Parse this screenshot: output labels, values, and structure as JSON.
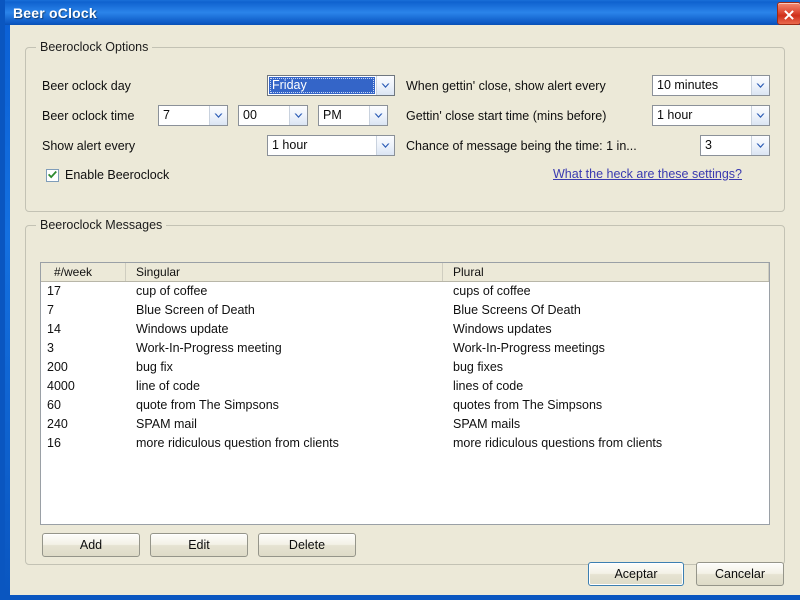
{
  "window": {
    "title": "Beer oClock",
    "close_icon": "close-icon"
  },
  "options_group": {
    "legend": "Beeroclock Options",
    "labels": {
      "day": "Beer oclock day",
      "time": "Beer oclock time",
      "show_alert_every": "Show alert every",
      "gettin_close_alert": "When gettin' close, show alert every",
      "gettin_close_start": "Gettin' close start time (mins before)",
      "chance": "Chance of message being the time: 1 in..."
    },
    "values": {
      "day": "Friday",
      "hour": "7",
      "minute": "00",
      "meridiem": "PM",
      "show_alert_every": "1 hour",
      "gettin_close_alert": "10 minutes",
      "gettin_close_start": "1 hour",
      "chance": "3"
    },
    "enable_checkbox": {
      "label": "Enable Beeroclock",
      "checked": true
    },
    "help_link": "What the heck are these settings?"
  },
  "messages_group": {
    "legend": "Beeroclock Messages",
    "columns": [
      "#/week",
      "Singular",
      "Plural"
    ],
    "rows": [
      {
        "week": "17",
        "singular": "cup of coffee",
        "plural": "cups of coffee"
      },
      {
        "week": "7",
        "singular": "Blue Screen of Death",
        "plural": "Blue Screens Of Death"
      },
      {
        "week": "14",
        "singular": "Windows update",
        "plural": "Windows updates"
      },
      {
        "week": "3",
        "singular": "Work-In-Progress meeting",
        "plural": "Work-In-Progress meetings"
      },
      {
        "week": "200",
        "singular": "bug fix",
        "plural": "bug fixes"
      },
      {
        "week": "4000",
        "singular": "line of code",
        "plural": "lines of code"
      },
      {
        "week": "60",
        "singular": "quote from The Simpsons",
        "plural": "quotes from The Simpsons"
      },
      {
        "week": "240",
        "singular": "SPAM mail",
        "plural": "SPAM mails"
      },
      {
        "week": "16",
        "singular": "more ridiculous question from clients",
        "plural": "more ridiculous questions from clients"
      }
    ],
    "buttons": {
      "add": "Add",
      "edit": "Edit",
      "delete": "Delete"
    }
  },
  "dialog_buttons": {
    "accept": "Aceptar",
    "cancel": "Cancelar"
  },
  "colors": {
    "titlebar_blue": "#1470e0",
    "client_background": "#ece9d8",
    "selection_blue": "#3465c8",
    "link": "#3a3ab0",
    "close_red": "#cf2f1a",
    "check_green": "#2d8a2d"
  }
}
